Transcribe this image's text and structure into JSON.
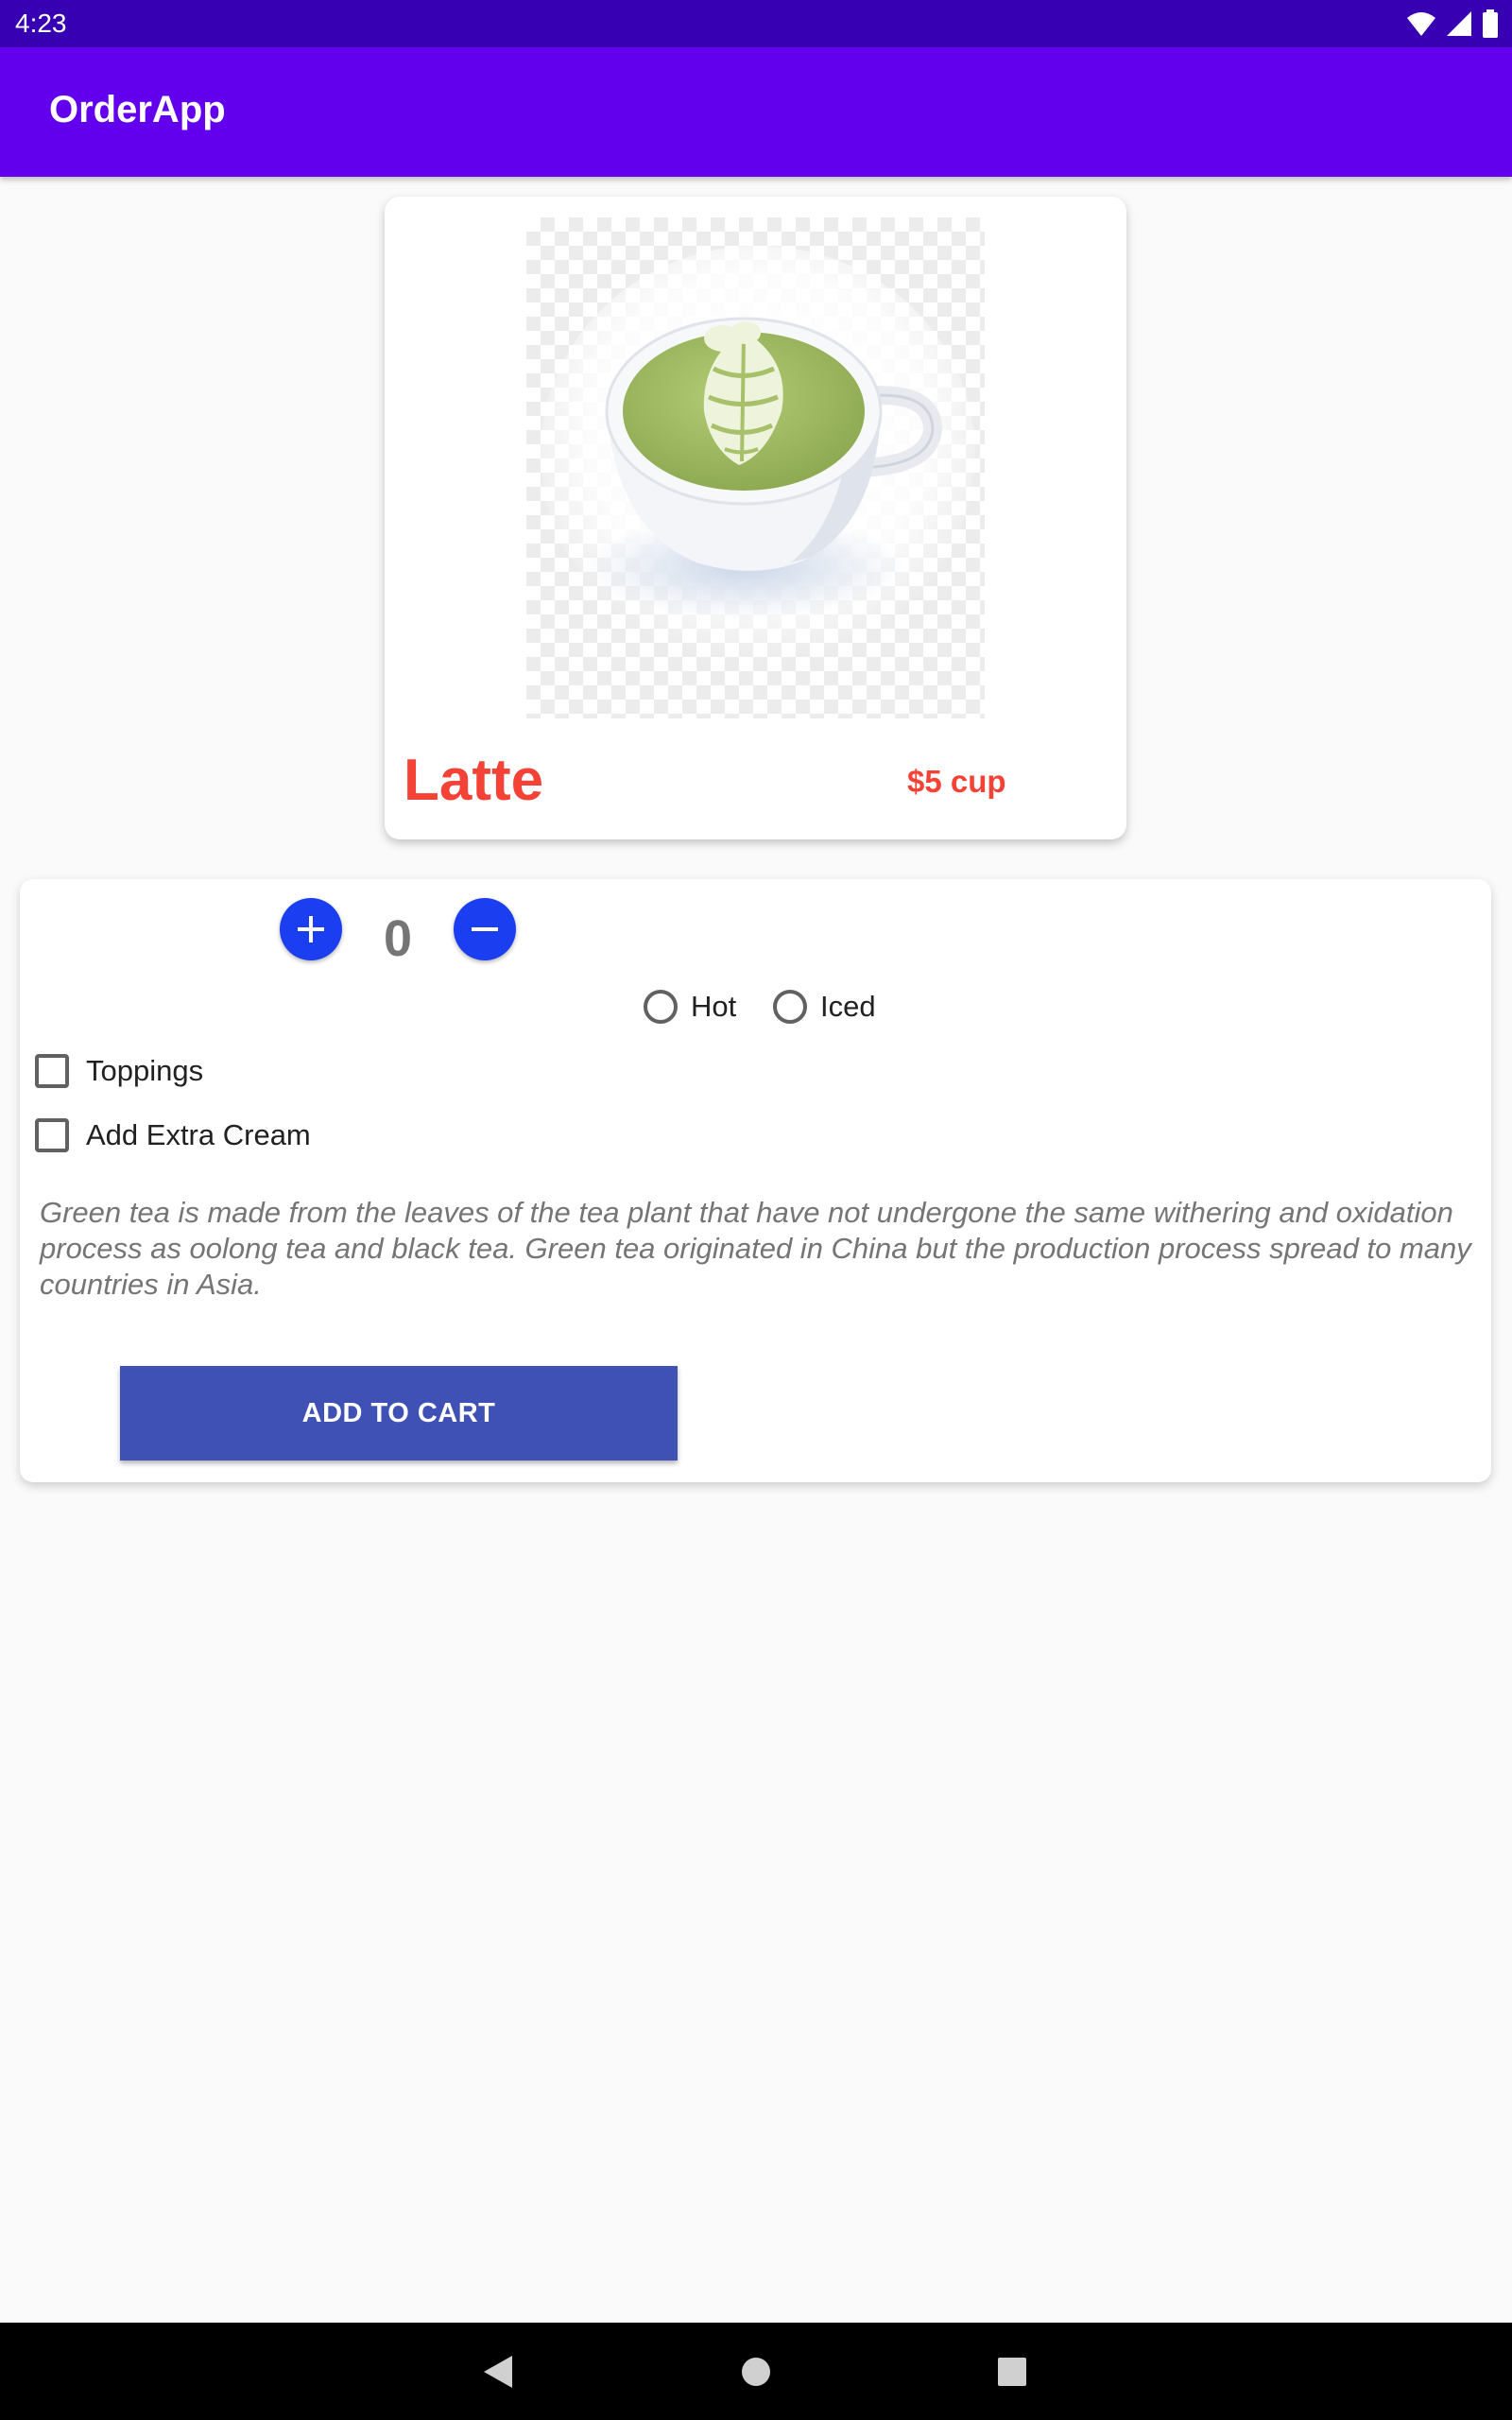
{
  "status_bar": {
    "time": "4:23",
    "icons": [
      "wifi-icon",
      "signal-icon",
      "battery-icon"
    ]
  },
  "app_bar": {
    "title": "OrderApp",
    "color": "#6200ee"
  },
  "product": {
    "name": "Latte",
    "price": "$5 cup",
    "image_icon": "latte-cup-image",
    "accent_color": "#f44336"
  },
  "quantity": {
    "value": "0",
    "plus_icon": "plus-icon",
    "minus_icon": "minus-icon"
  },
  "temperature": {
    "options": [
      "Hot",
      "Iced"
    ]
  },
  "extras": {
    "toppings": "Toppings",
    "cream": "Add Extra Cream"
  },
  "description": "Green tea is made from the leaves of the tea plant that have not undergone the same withering and oxidation process as oolong tea and black tea. Green tea originated in China but the production process spread to many countries in Asia.",
  "cart": {
    "label": "ADD TO CART",
    "color": "#3f51b5"
  },
  "nav_bar": {
    "icons": [
      "back-icon",
      "home-icon",
      "recents-icon"
    ]
  }
}
